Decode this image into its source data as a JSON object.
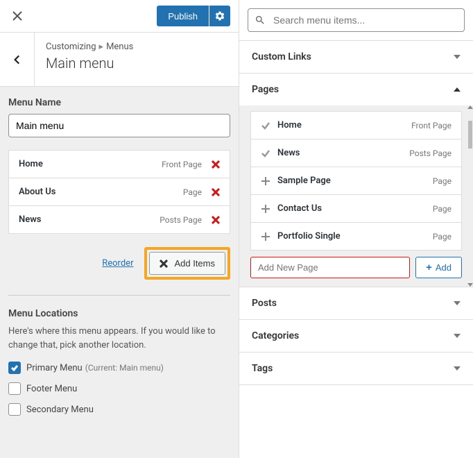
{
  "header": {
    "publish_label": "Publish"
  },
  "breadcrumb": {
    "prefix": "Customizing",
    "section": "Menus",
    "title": "Main menu"
  },
  "menu_name": {
    "label": "Menu Name",
    "value": "Main menu"
  },
  "menu_items": [
    {
      "label": "Home",
      "type": "Front Page"
    },
    {
      "label": "About Us",
      "type": "Page"
    },
    {
      "label": "News",
      "type": "Posts Page"
    }
  ],
  "actions": {
    "reorder": "Reorder",
    "add_items": "Add Items"
  },
  "locations": {
    "heading": "Menu Locations",
    "help": "Here's where this menu appears. If you would like to change that, pick another location.",
    "items": [
      {
        "label": "Primary Menu",
        "sublabel": "(Current: Main menu)",
        "checked": true
      },
      {
        "label": "Footer Menu",
        "sublabel": "",
        "checked": false
      },
      {
        "label": "Secondary Menu",
        "sublabel": "",
        "checked": false
      }
    ]
  },
  "search": {
    "placeholder": "Search menu items..."
  },
  "accordion": {
    "custom_links": "Custom Links",
    "pages": "Pages",
    "posts": "Posts",
    "categories": "Categories",
    "tags": "Tags"
  },
  "pages_list": [
    {
      "label": "Home",
      "type": "Front Page",
      "added": true
    },
    {
      "label": "News",
      "type": "Posts Page",
      "added": true
    },
    {
      "label": "Sample Page",
      "type": "Page",
      "added": false
    },
    {
      "label": "Contact Us",
      "type": "Page",
      "added": false
    },
    {
      "label": "Portfolio Single",
      "type": "Page",
      "added": false
    }
  ],
  "add_new_page": {
    "placeholder": "Add New Page",
    "button": "Add"
  }
}
